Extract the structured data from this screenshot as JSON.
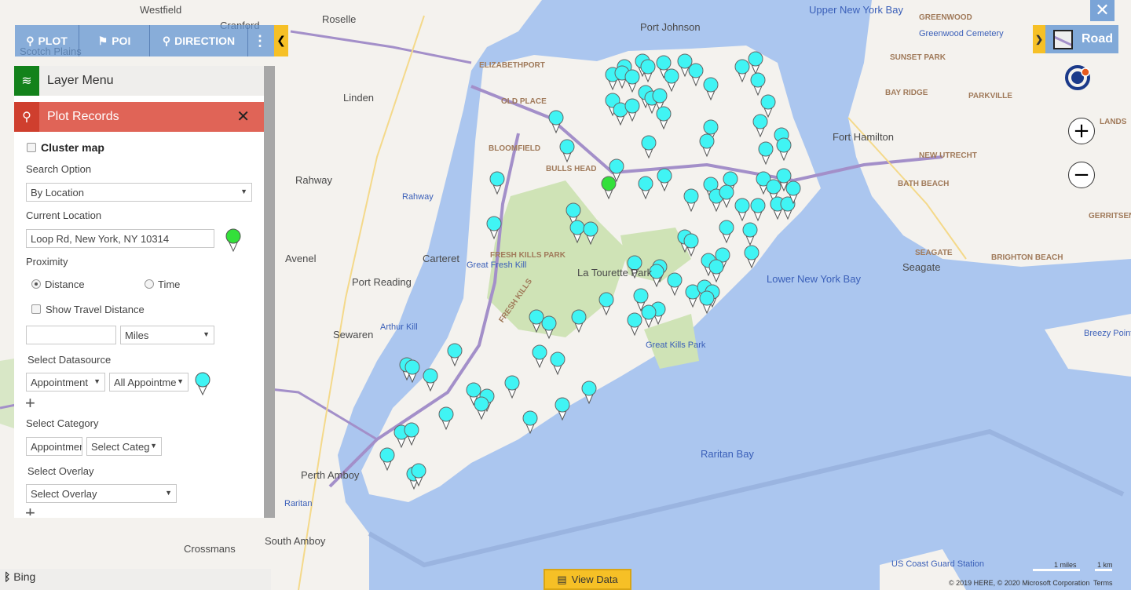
{
  "map": {
    "colors": {
      "water": "#abc6ef",
      "land": "#f4f2ee",
      "park": "#cfe3b6",
      "highway": "#a38fc9",
      "pin": "#40f4f4",
      "current_pin": "#33e03a"
    },
    "labels": [
      "Roselle",
      "Westfield",
      "Cranford",
      "Scotch Plains",
      "Port Johnson",
      "Upper New York Bay",
      "ELIZABETHPORT",
      "OLD PLACE",
      "Linden",
      "BLOOMFIELD",
      "BULLS HEAD",
      "Rahway",
      "Rahway",
      "Carteret",
      "FRESH KILLS PARK",
      "Avenel",
      "Port Reading",
      "Great Fresh Kill",
      "FRESH KILLS",
      "La Tourette Park",
      "Sewaren",
      "Arthur Kill",
      "Great Kills Park",
      "Lower New York Bay",
      "Fort Hamilton",
      "Raritan Bay",
      "Perth Amboy",
      "Raritan",
      "South Amboy",
      "Crossmans",
      "GREENWOOD",
      "Greenwood Cemetery",
      "SUNSET PARK",
      "BAY RIDGE",
      "PARKVILLE",
      "NEW UTRECHT",
      "BATH BEACH",
      "SEAGATE",
      "Seagate",
      "BRIGHTON BEACH",
      "GERRITSEN",
      "Breezy Point Park",
      "US Coast Guard Station",
      "LANDS"
    ]
  },
  "toolbar": {
    "items": [
      {
        "label": "PLOT",
        "icon": "map-pin-icon"
      },
      {
        "label": "POI",
        "icon": "poi-icon"
      },
      {
        "label": "DIRECTION",
        "icon": "direction-icon"
      }
    ],
    "more_icon": "more-vertical-icon",
    "collapse_icon": "chevron-left-icon"
  },
  "layer_menu": {
    "title": "Layer Menu",
    "icon": "layers-icon"
  },
  "plot_records": {
    "title": "Plot Records",
    "cluster_label": "Cluster map",
    "search_option_label": "Search Option",
    "search_option_value": "By Location",
    "current_location_label": "Current Location",
    "current_location_value": "Loop Rd, New York, NY 10314",
    "proximity_label": "Proximity",
    "distance_label": "Distance",
    "time_label": "Time",
    "proximity_selected": "Distance",
    "show_travel_label": "Show Travel Distance",
    "distance_value": "",
    "unit_value": "Miles",
    "datasource_label": "Select Datasource",
    "datasource_value": "Appointment",
    "view_value": "All Appointme",
    "category_label": "Select Category",
    "category_entity_value": "Appointmer",
    "category_value": "Select Categ",
    "overlay_label": "Select Overlay",
    "overlay_value": "Select Overlay"
  },
  "map_controls": {
    "road_label": "Road",
    "close_icon": "close-icon",
    "zoom_in": "+",
    "zoom_out": "−"
  },
  "footer": {
    "bing": "Bing",
    "view_data": "View Data",
    "scale_miles": "1 miles",
    "scale_km": "1 km",
    "copyright": "© 2019 HERE, © 2020 Microsoft Corporation",
    "terms": "Terms"
  }
}
